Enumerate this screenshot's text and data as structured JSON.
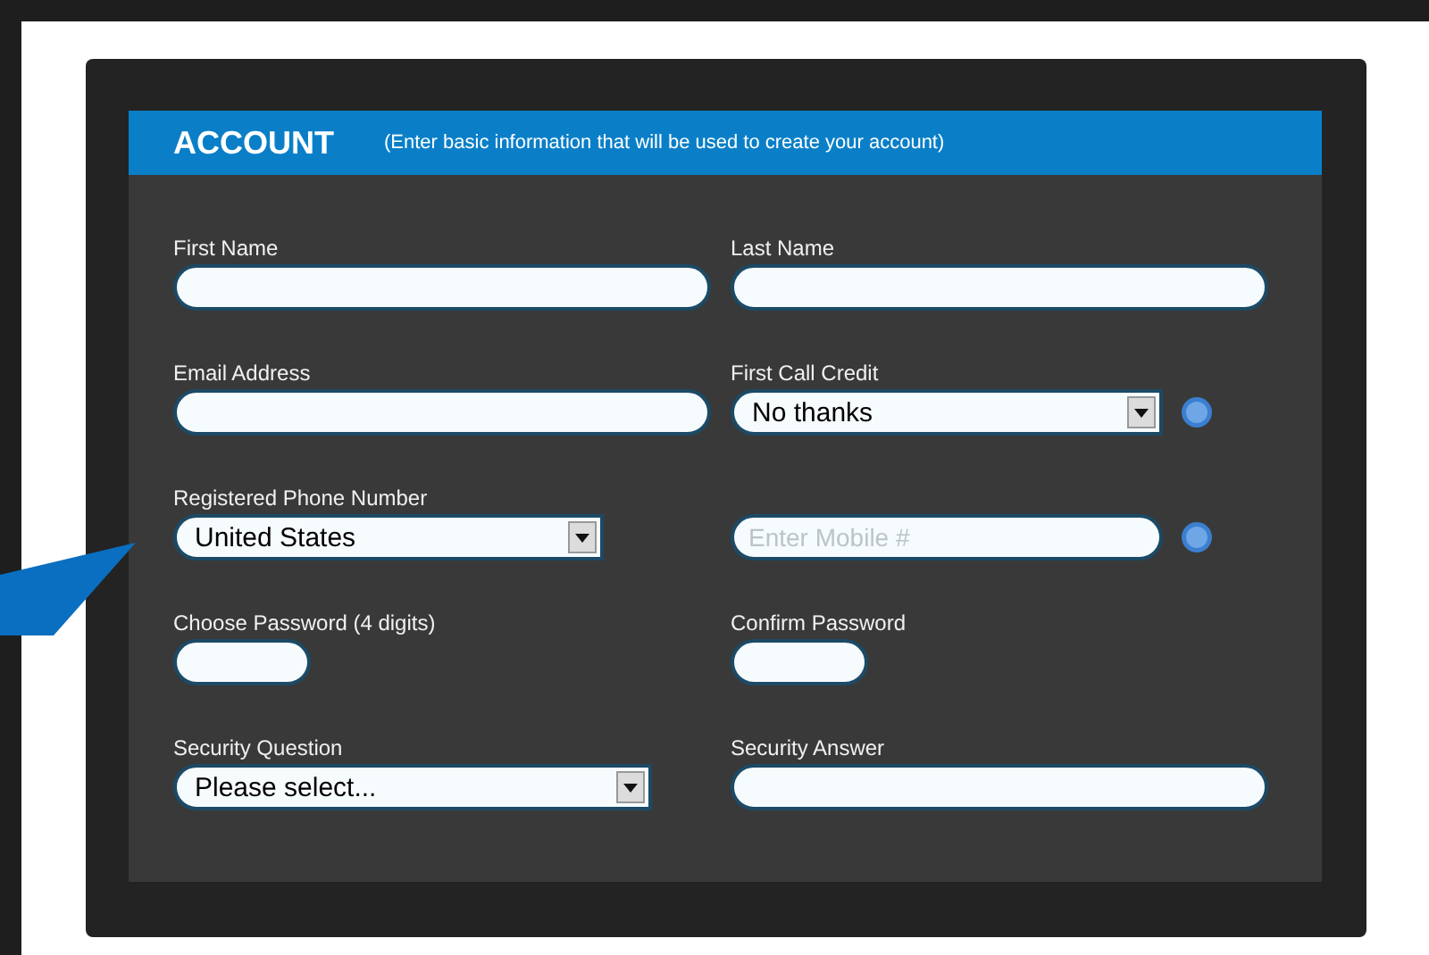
{
  "header": {
    "title": "ACCOUNT",
    "note": "(Enter basic information that will be used to create your account)"
  },
  "rows": [
    [
      {
        "label": "First Name",
        "kind": "text"
      },
      {
        "label": "Last Name",
        "kind": "text"
      }
    ],
    [
      {
        "label": "Email Address",
        "kind": "text"
      },
      {
        "label": "First Call Credit",
        "kind": "select",
        "value": "No thanks",
        "help": true
      }
    ],
    [
      {
        "label": "Registered Phone Number",
        "kind": "select",
        "value": "United States"
      },
      {
        "kind": "text",
        "placeholder": "Enter Mobile #",
        "help": true
      }
    ],
    [
      {
        "label": "Choose Password (4 digits)",
        "kind": "pin"
      },
      {
        "label": "Confirm Password",
        "kind": "pin"
      }
    ],
    [
      {
        "label": "Security Question",
        "kind": "select",
        "value": "Please select..."
      },
      {
        "label": "Security Answer",
        "kind": "text"
      }
    ]
  ]
}
